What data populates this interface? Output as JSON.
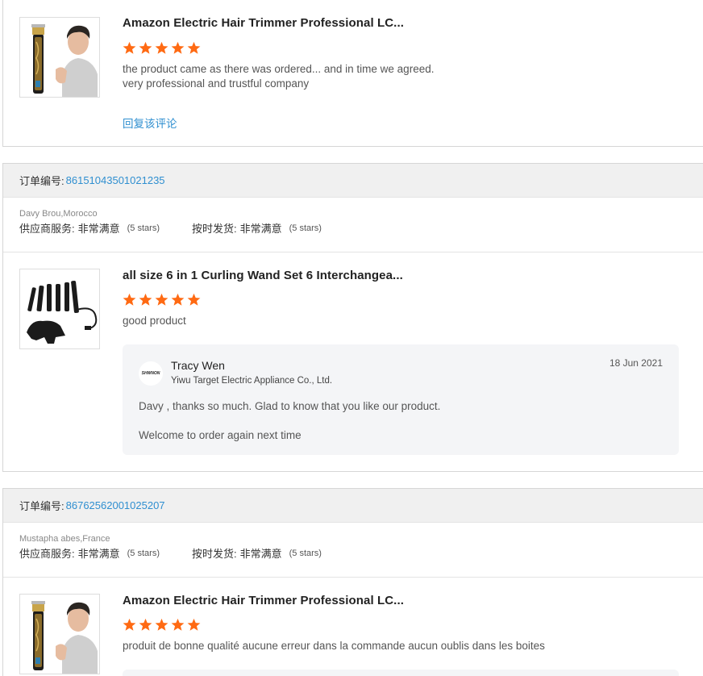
{
  "theme": {
    "accent": "#2f8fd0",
    "star_color": "#ff6a13"
  },
  "reviews": [
    {
      "product_title": "Amazon Electric Hair Trimmer Professional LC...",
      "rating": 5,
      "text_line1": "the product came as there was ordered... and in time we agreed.",
      "text_line2": "very professional and trustful company",
      "reply_link": "回复该评论"
    },
    {
      "order_label": "订单编号:",
      "order_number": "86151043501021235",
      "buyer": "Davy Brou,Morocco",
      "service_label": "供应商服务:",
      "service_value": "非常满意",
      "service_stars": "(5 stars)",
      "shipping_label": "按时发货:",
      "shipping_value": "非常满意",
      "shipping_stars": "(5 stars)",
      "product_title": "all size 6 in 1 Curling Wand Set 6 Interchangea...",
      "rating": 5,
      "text_line1": "good product",
      "seller_reply": {
        "avatar_text": "SHWNON",
        "name": "Tracy Wen",
        "company": "Yiwu Target Electric Appliance Co., Ltd.",
        "date": "18 Jun 2021",
        "line1": "Davy , thanks so much. Glad to know that you like our product.",
        "line2": "Welcome to order again next time"
      }
    },
    {
      "order_label": "订单编号:",
      "order_number": "86762562001025207",
      "buyer": "Mustapha abes,France",
      "service_label": "供应商服务:",
      "service_value": "非常满意",
      "service_stars": "(5 stars)",
      "shipping_label": "按时发货:",
      "shipping_value": "非常满意",
      "shipping_stars": "(5 stars)",
      "product_title": "Amazon Electric Hair Trimmer Professional LC...",
      "rating": 5,
      "text_line1": "produit de bonne qualité aucune erreur dans la commande aucun oublis dans les boites"
    }
  ]
}
